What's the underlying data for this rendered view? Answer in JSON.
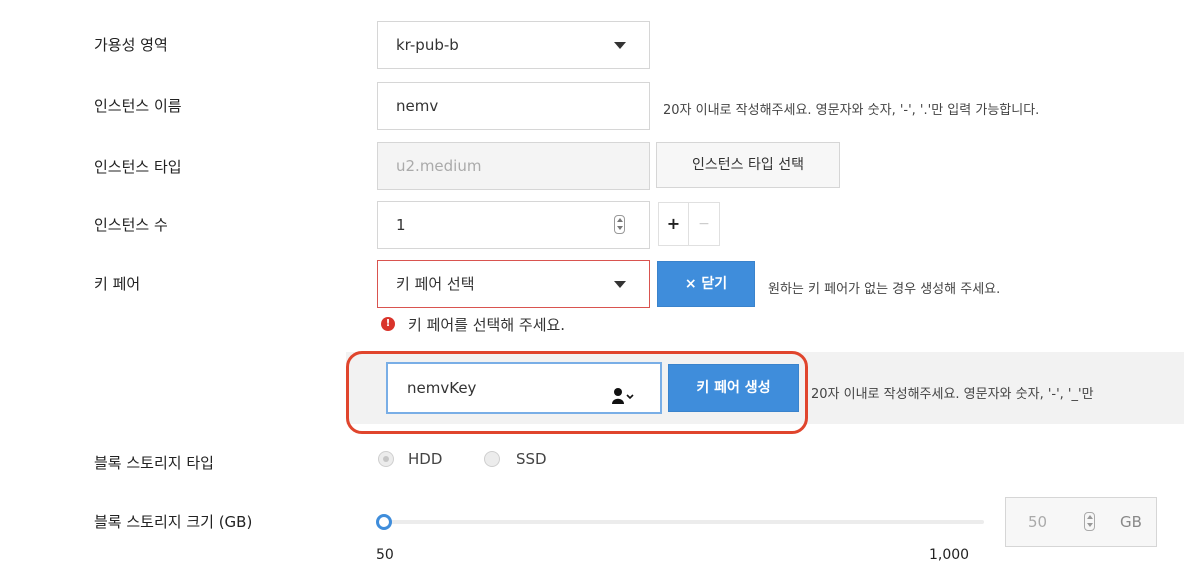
{
  "form": {
    "availability_zone": {
      "label": "가용성 영역",
      "value": "kr-pub-b"
    },
    "instance_name": {
      "label": "인스턴스 이름",
      "value": "nemv",
      "hint": "20자 이내로 작성해주세요. 영문자와 숫자, '-', '.'만 입력 가능합니다."
    },
    "instance_type": {
      "label": "인스턴스 타입",
      "placeholder": "u2.medium",
      "select_button": "인스턴스 타입 선택"
    },
    "instance_count": {
      "label": "인스턴스 수",
      "value": "1",
      "plus": "+",
      "minus": "−"
    },
    "key_pair": {
      "label": "키 페어",
      "select_value": "키 페어 선택",
      "close_button": "× 닫기",
      "hint": "원하는 키 페어가 없는 경우 생성해 주세요.",
      "error": "키 페어를 선택해 주세요.",
      "new_key_value": "nemvKey",
      "create_button": "키 페어 생성",
      "create_hint": "20자 이내로 작성해주세요. 영문자와 숫자, '-', '_'만"
    },
    "storage_type": {
      "label": "블록 스토리지 타입",
      "options": [
        "HDD",
        "SSD"
      ],
      "selected": "HDD"
    },
    "storage_size": {
      "label": "블록 스토리지 크기 (GB)",
      "value": "50",
      "unit": "GB",
      "min_label": "50",
      "max_label": "1,000",
      "slider_fraction": 0
    }
  },
  "colors": {
    "error_red": "#d9534f",
    "highlight_red": "#e0452d",
    "primary_blue": "#3f8ddb",
    "focus_blue": "#79aee6"
  }
}
